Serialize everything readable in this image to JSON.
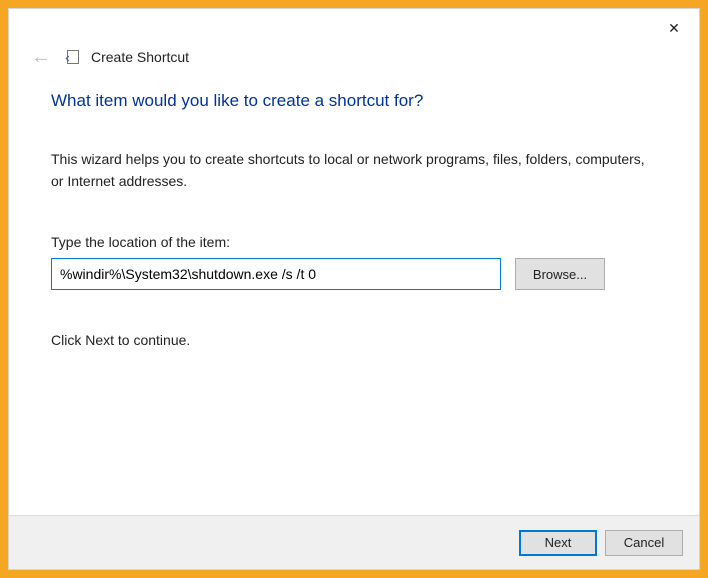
{
  "window": {
    "close_symbol": "✕"
  },
  "header": {
    "back_symbol": "←",
    "title": "Create Shortcut"
  },
  "main": {
    "heading": "What item would you like to create a shortcut for?",
    "help_text": "This wizard helps you to create shortcuts to local or network programs, files, folders, computers, or Internet addresses.",
    "location_label": "Type the location of the item:",
    "location_value": "%windir%\\System32\\shutdown.exe /s /t 0",
    "browse_label": "Browse...",
    "continue_text": "Click Next to continue."
  },
  "footer": {
    "next_label": "Next",
    "cancel_label": "Cancel"
  }
}
